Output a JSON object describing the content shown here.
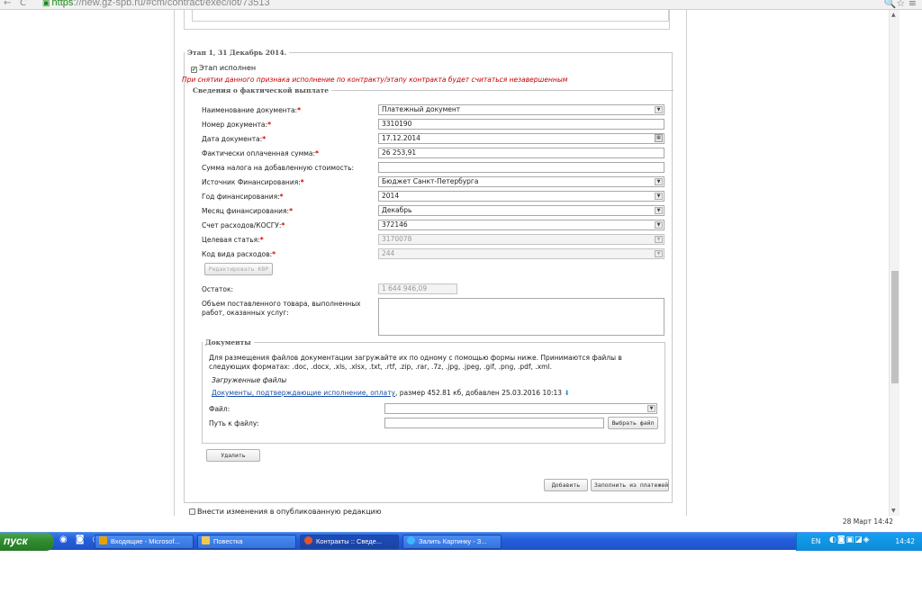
{
  "browser": {
    "back": "←",
    "reload": "C",
    "url_scheme": "https",
    "url_rest": "://new.gz-spb.ru/#cm/contract/exec/lot/73513",
    "right_icons": "🔍☆ ≡"
  },
  "stage": {
    "legend": "Этап 1, 31 Декабрь 2014.",
    "completed_label": "Этап исполнен",
    "completed_checked": "✔",
    "warning": "При снятии данного признака исполнение по контракту/этапу контракта будет считаться незавершенным",
    "payment_legend": "Сведения о фактической выплате"
  },
  "fields": {
    "doc_name": {
      "label": "Наименование документа:",
      "value": "Платежный документ"
    },
    "doc_number": {
      "label": "Номер документа:",
      "value": "3310190"
    },
    "doc_date": {
      "label": "Дата документа:",
      "value": "17.12.2014"
    },
    "paid_sum": {
      "label": "Фактически оплаченная сумма:",
      "value": "26 253,91"
    },
    "vat_sum": {
      "label": "Сумма налога на добавленную стоимость:",
      "value": ""
    },
    "fin_source": {
      "label": "Источник Финансирования:",
      "value": "Бюджет Санкт-Петербурга"
    },
    "fin_year": {
      "label": "Год финансирования:",
      "value": "2014"
    },
    "fin_month": {
      "label": "Месяц финансирования:",
      "value": "Декабрь"
    },
    "expense_account": {
      "label": "Счет расходов/КОСГУ:",
      "value": "372146"
    },
    "target_article": {
      "label": "Целевая статья:",
      "value": "3170078"
    },
    "expense_code": {
      "label": "Код вида расходов:",
      "value": "244"
    },
    "edit_kvr": "Редактировать КВР",
    "remainder": {
      "label": "Остаток:",
      "value": "1 644 946,09"
    },
    "volume": {
      "label": "Объем поставленного товара, выполненных работ, оказанных услуг:",
      "value": ""
    }
  },
  "documents": {
    "legend": "Документы",
    "instructions": "Для размещения файлов документации загружайте их по одному с помощью формы ниже. Принимаются файлы в следующих форматах: .doc, .docx, .xls, .xlsx, .txt, .rtf, .zip, .rar, .7z, .jpg, .jpeg, .gif, .png, .pdf, .xml.",
    "uploaded_label": "Загруженные файлы",
    "file_link": "Документы, подтверждающие исполнение, оплату",
    "file_meta": ", размер 452.81 кб, добавлен 25.03.2016 10:13",
    "file_label": "Файл:",
    "file_value": "",
    "path_label": "Путь к файлу:",
    "path_value": "",
    "choose_file": "Выбрать файл",
    "delete": "Удалить"
  },
  "actions": {
    "add": "Добавить",
    "fill_from_payments": "Заполнить из платежей",
    "publish_changes": "Внести изменения в опубликованную редакцию"
  },
  "datebar": {
    "date": "28 Март 14:42"
  },
  "taskbar": {
    "start": "пуск",
    "quick_launch": "◉ ◙ ◎",
    "tasks": [
      {
        "label": "Входящие - Microsof...",
        "icon_color": "#e8a000"
      },
      {
        "label": "Повестка",
        "icon_color": "#f2c84b"
      },
      {
        "label": "Контракты :: Сведе...",
        "icon_color": "#e0562a"
      },
      {
        "label": "Залить Картинку - З...",
        "icon_color": "#3fb7ff"
      }
    ],
    "lang": "EN",
    "tray_icons": "◐◙▣◪◈",
    "clock": "14:42"
  }
}
